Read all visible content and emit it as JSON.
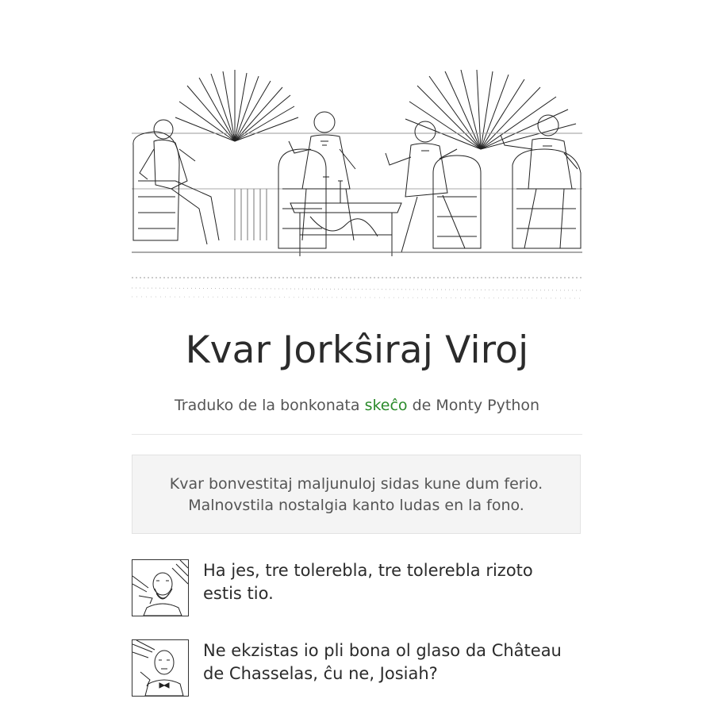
{
  "header": {
    "title": "Kvar Jorkŝiraj Viroj",
    "subtitle_before": "Traduko de la bonkonata ",
    "subtitle_link": "skeĉo",
    "subtitle_after": " de Monty Python"
  },
  "intro": {
    "line1": "Kvar bonvestitaj maljunuloj sidas kune dum ferio.",
    "line2": "Malnovstila nostalgia kanto ludas en la fono."
  },
  "dialogue": [
    {
      "avatar_icon": "bearded-man-portrait-icon",
      "text": "Ha jes, tre tolerebla, tre tolerebla rizoto estis tio."
    },
    {
      "avatar_icon": "gentleman-bowtie-portrait-icon",
      "text": "Ne ekzistas io pli bona ol glaso da Château de Chasselas, ĉu ne, Josiah?"
    }
  ],
  "colors": {
    "link": "#2a8a2a",
    "box_bg": "#f4f4f4",
    "text": "#333333"
  }
}
